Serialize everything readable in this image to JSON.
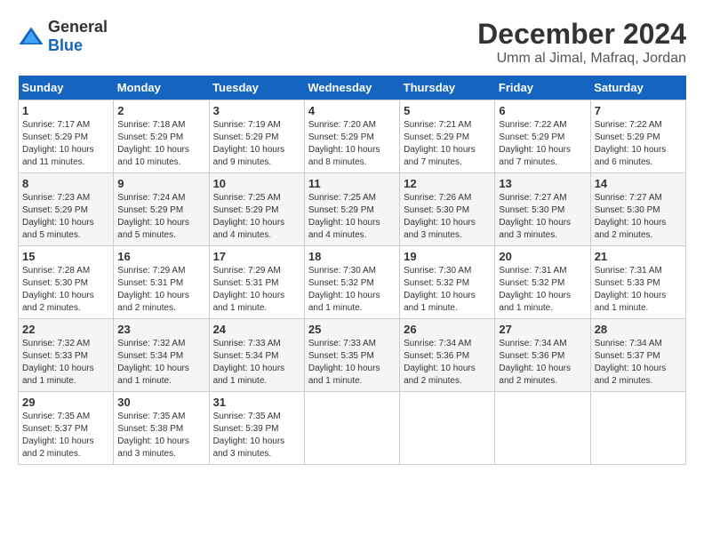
{
  "logo": {
    "text_general": "General",
    "text_blue": "Blue"
  },
  "header": {
    "month_year": "December 2024",
    "location": "Umm al Jimal, Mafraq, Jordan"
  },
  "calendar": {
    "days_of_week": [
      "Sunday",
      "Monday",
      "Tuesday",
      "Wednesday",
      "Thursday",
      "Friday",
      "Saturday"
    ],
    "weeks": [
      [
        null,
        {
          "day": "2",
          "sunrise": "7:18 AM",
          "sunset": "5:29 PM",
          "daylight": "10 hours and 10 minutes."
        },
        {
          "day": "3",
          "sunrise": "7:19 AM",
          "sunset": "5:29 PM",
          "daylight": "10 hours and 9 minutes."
        },
        {
          "day": "4",
          "sunrise": "7:20 AM",
          "sunset": "5:29 PM",
          "daylight": "10 hours and 8 minutes."
        },
        {
          "day": "5",
          "sunrise": "7:21 AM",
          "sunset": "5:29 PM",
          "daylight": "10 hours and 7 minutes."
        },
        {
          "day": "6",
          "sunrise": "7:22 AM",
          "sunset": "5:29 PM",
          "daylight": "10 hours and 7 minutes."
        },
        {
          "day": "7",
          "sunrise": "7:22 AM",
          "sunset": "5:29 PM",
          "daylight": "10 hours and 6 minutes."
        }
      ],
      [
        {
          "day": "1",
          "sunrise": "7:17 AM",
          "sunset": "5:29 PM",
          "daylight": "10 hours and 11 minutes."
        },
        {
          "day": "8",
          "sunrise": "7:23 AM",
          "sunset": "5:29 PM",
          "daylight": "10 hours and 5 minutes."
        },
        {
          "day": "9",
          "sunrise": "7:24 AM",
          "sunset": "5:29 PM",
          "daylight": "10 hours and 5 minutes."
        },
        {
          "day": "10",
          "sunrise": "7:25 AM",
          "sunset": "5:29 PM",
          "daylight": "10 hours and 4 minutes."
        },
        {
          "day": "11",
          "sunrise": "7:25 AM",
          "sunset": "5:29 PM",
          "daylight": "10 hours and 4 minutes."
        },
        {
          "day": "12",
          "sunrise": "7:26 AM",
          "sunset": "5:30 PM",
          "daylight": "10 hours and 3 minutes."
        },
        {
          "day": "13",
          "sunrise": "7:27 AM",
          "sunset": "5:30 PM",
          "daylight": "10 hours and 3 minutes."
        },
        {
          "day": "14",
          "sunrise": "7:27 AM",
          "sunset": "5:30 PM",
          "daylight": "10 hours and 2 minutes."
        }
      ],
      [
        {
          "day": "15",
          "sunrise": "7:28 AM",
          "sunset": "5:30 PM",
          "daylight": "10 hours and 2 minutes."
        },
        {
          "day": "16",
          "sunrise": "7:29 AM",
          "sunset": "5:31 PM",
          "daylight": "10 hours and 2 minutes."
        },
        {
          "day": "17",
          "sunrise": "7:29 AM",
          "sunset": "5:31 PM",
          "daylight": "10 hours and 1 minute."
        },
        {
          "day": "18",
          "sunrise": "7:30 AM",
          "sunset": "5:32 PM",
          "daylight": "10 hours and 1 minute."
        },
        {
          "day": "19",
          "sunrise": "7:30 AM",
          "sunset": "5:32 PM",
          "daylight": "10 hours and 1 minute."
        },
        {
          "day": "20",
          "sunrise": "7:31 AM",
          "sunset": "5:32 PM",
          "daylight": "10 hours and 1 minute."
        },
        {
          "day": "21",
          "sunrise": "7:31 AM",
          "sunset": "5:33 PM",
          "daylight": "10 hours and 1 minute."
        }
      ],
      [
        {
          "day": "22",
          "sunrise": "7:32 AM",
          "sunset": "5:33 PM",
          "daylight": "10 hours and 1 minute."
        },
        {
          "day": "23",
          "sunrise": "7:32 AM",
          "sunset": "5:34 PM",
          "daylight": "10 hours and 1 minute."
        },
        {
          "day": "24",
          "sunrise": "7:33 AM",
          "sunset": "5:34 PM",
          "daylight": "10 hours and 1 minute."
        },
        {
          "day": "25",
          "sunrise": "7:33 AM",
          "sunset": "5:35 PM",
          "daylight": "10 hours and 1 minute."
        },
        {
          "day": "26",
          "sunrise": "7:34 AM",
          "sunset": "5:36 PM",
          "daylight": "10 hours and 2 minutes."
        },
        {
          "day": "27",
          "sunrise": "7:34 AM",
          "sunset": "5:36 PM",
          "daylight": "10 hours and 2 minutes."
        },
        {
          "day": "28",
          "sunrise": "7:34 AM",
          "sunset": "5:37 PM",
          "daylight": "10 hours and 2 minutes."
        }
      ],
      [
        {
          "day": "29",
          "sunrise": "7:35 AM",
          "sunset": "5:37 PM",
          "daylight": "10 hours and 2 minutes."
        },
        {
          "day": "30",
          "sunrise": "7:35 AM",
          "sunset": "5:38 PM",
          "daylight": "10 hours and 3 minutes."
        },
        {
          "day": "31",
          "sunrise": "7:35 AM",
          "sunset": "5:39 PM",
          "daylight": "10 hours and 3 minutes."
        },
        null,
        null,
        null,
        null
      ]
    ]
  }
}
